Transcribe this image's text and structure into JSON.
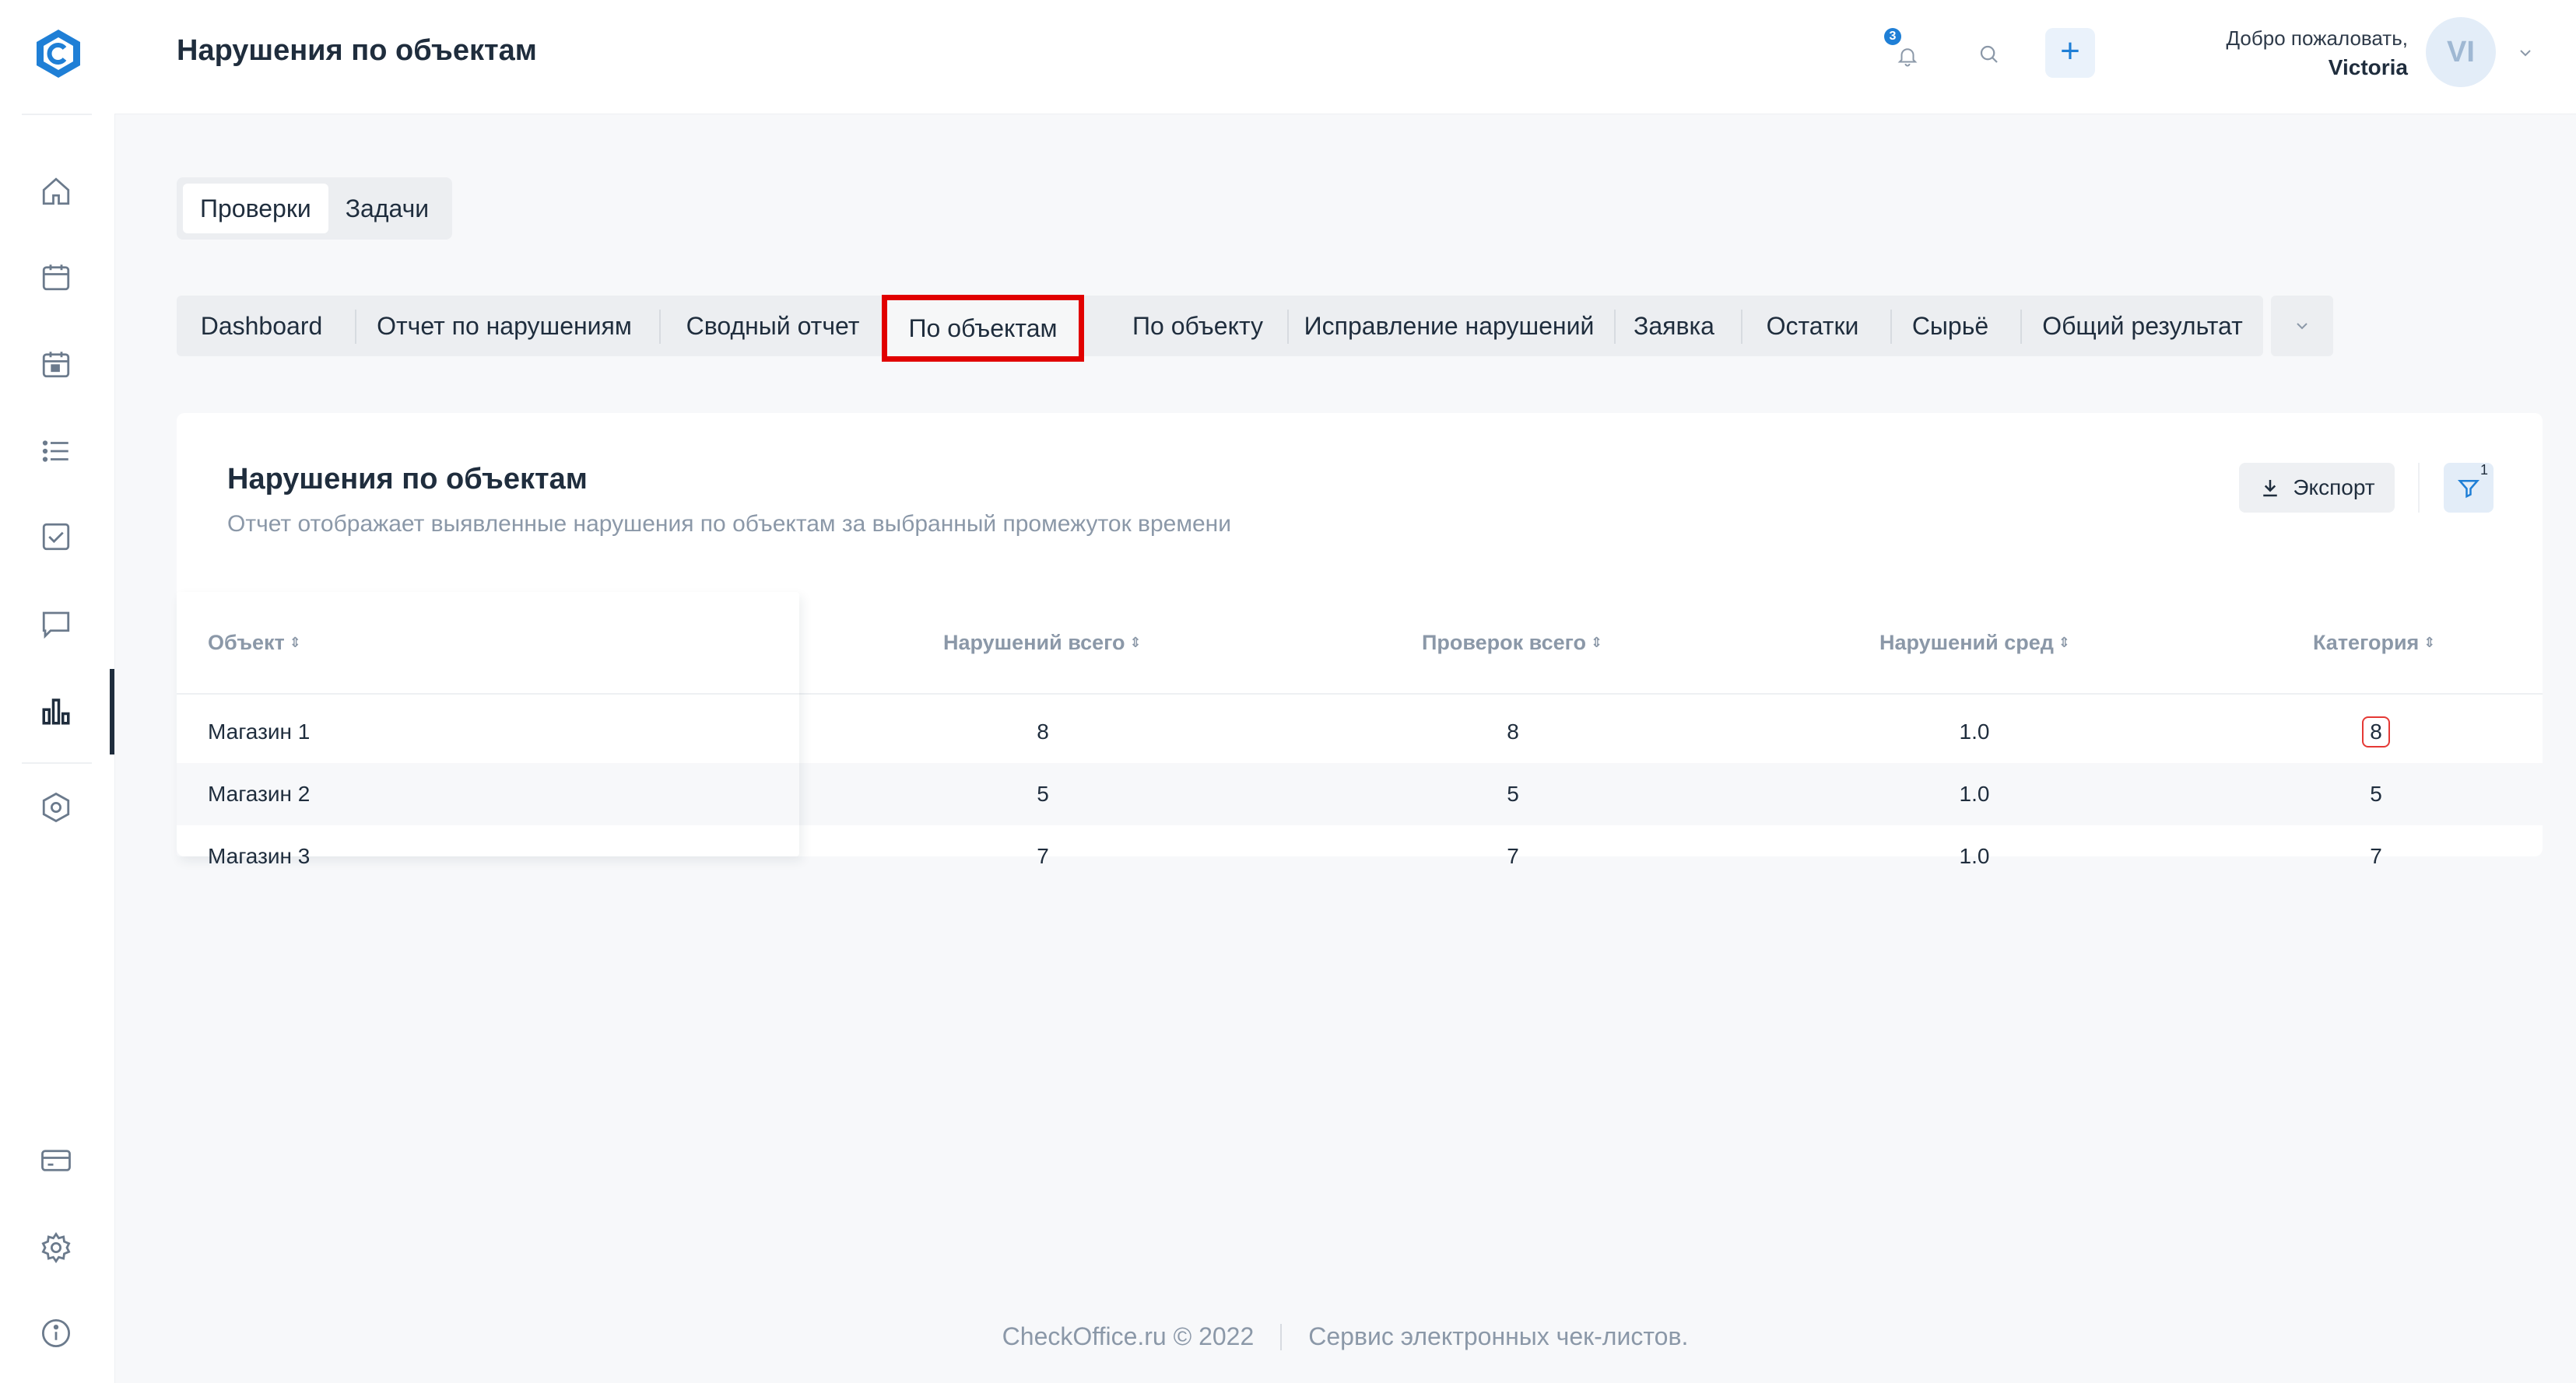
{
  "header": {
    "title": "Нарушения по объектам",
    "notifications_count": "3",
    "welcome_line": "Добро пожаловать,",
    "user_name": "Victoria",
    "avatar_initials": "VI"
  },
  "sidebar": {
    "items": [
      {
        "icon": "home-icon"
      },
      {
        "icon": "calendar-icon"
      },
      {
        "icon": "calendar-day-icon"
      },
      {
        "icon": "list-icon"
      },
      {
        "icon": "checkbox-icon"
      },
      {
        "icon": "chat-icon"
      },
      {
        "icon": "bar-chart-icon",
        "active": true
      },
      {
        "icon": "hexagon-settings-icon"
      },
      {
        "icon": "credit-card-icon"
      },
      {
        "icon": "gear-icon"
      },
      {
        "icon": "info-icon"
      }
    ]
  },
  "top_tabs": [
    {
      "label": "Проверки",
      "active": true
    },
    {
      "label": "Задачи",
      "active": false
    }
  ],
  "report_tabs": [
    {
      "label": "Dashboard"
    },
    {
      "label": "Отчет по нарушениям"
    },
    {
      "label": "Сводный отчет"
    },
    {
      "label": "По объектам",
      "active": true
    },
    {
      "label": "По объекту"
    },
    {
      "label": "Исправление нарушений"
    },
    {
      "label": "Заявка"
    },
    {
      "label": "Остатки"
    },
    {
      "label": "Сырьё"
    },
    {
      "label": "Общий результат"
    }
  ],
  "card": {
    "title": "Нарушения по объектам",
    "subtitle": "Отчет отображает выявленные нарушения по объектам за выбранный промежуток времени",
    "export_label": "Экспорт",
    "filter_count": "1"
  },
  "table": {
    "columns": [
      "Объект",
      "Нарушений всего",
      "Проверок всего",
      "Нарушений сред",
      "Категория"
    ],
    "rows": [
      [
        "Магазин 1",
        "8",
        "8",
        "1.0",
        "8"
      ],
      [
        "Магазин 2",
        "5",
        "5",
        "1.0",
        "5"
      ],
      [
        "Магазин 3",
        "7",
        "7",
        "1.0",
        "7"
      ]
    ]
  },
  "footer": {
    "copyright": "CheckOffice.ru © 2022",
    "tagline": "Сервис электронных чек-листов."
  },
  "colors": {
    "accent": "#1f7fd6",
    "highlight_border": "#e10000",
    "badge_border": "#e53935"
  }
}
